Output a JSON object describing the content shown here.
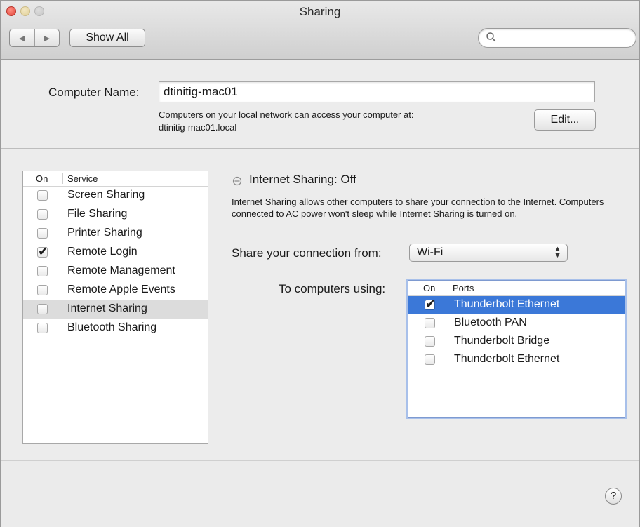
{
  "window": {
    "title": "Sharing"
  },
  "toolbar": {
    "back_icon": "◀",
    "forward_icon": "▶",
    "show_all_label": "Show All",
    "search_placeholder": ""
  },
  "computer_name": {
    "label": "Computer Name:",
    "value": "dtinitig-mac01",
    "description_line1": "Computers on your local network can access your computer at:",
    "description_line2": "dtinitig-mac01.local",
    "edit_label": "Edit..."
  },
  "services": {
    "header_on": "On",
    "header_service": "Service",
    "items": [
      {
        "label": "Screen Sharing",
        "checked": false,
        "selected": false
      },
      {
        "label": "File Sharing",
        "checked": false,
        "selected": false
      },
      {
        "label": "Printer Sharing",
        "checked": false,
        "selected": false
      },
      {
        "label": "Remote Login",
        "checked": true,
        "selected": false
      },
      {
        "label": "Remote Management",
        "checked": false,
        "selected": false
      },
      {
        "label": "Remote Apple Events",
        "checked": false,
        "selected": false
      },
      {
        "label": "Internet Sharing",
        "checked": false,
        "selected": true
      },
      {
        "label": "Bluetooth Sharing",
        "checked": false,
        "selected": false
      }
    ]
  },
  "detail": {
    "status_title": "Internet Sharing: Off",
    "description": "Internet Sharing allows other computers to share your connection to the Internet. Computers connected to AC power won't sleep while Internet Sharing is turned on.",
    "share_from_label": "Share your connection from:",
    "share_from_value": "Wi-Fi",
    "to_computers_label": "To computers using:",
    "ports_header_on": "On",
    "ports_header_ports": "Ports",
    "ports": [
      {
        "label": "Thunderbolt Ethernet",
        "checked": true,
        "selected": true
      },
      {
        "label": "Bluetooth PAN",
        "checked": false,
        "selected": false
      },
      {
        "label": "Thunderbolt Bridge",
        "checked": false,
        "selected": false
      },
      {
        "label": "Thunderbolt Ethernet",
        "checked": false,
        "selected": false
      }
    ]
  },
  "footer": {
    "help_label": "?"
  }
}
